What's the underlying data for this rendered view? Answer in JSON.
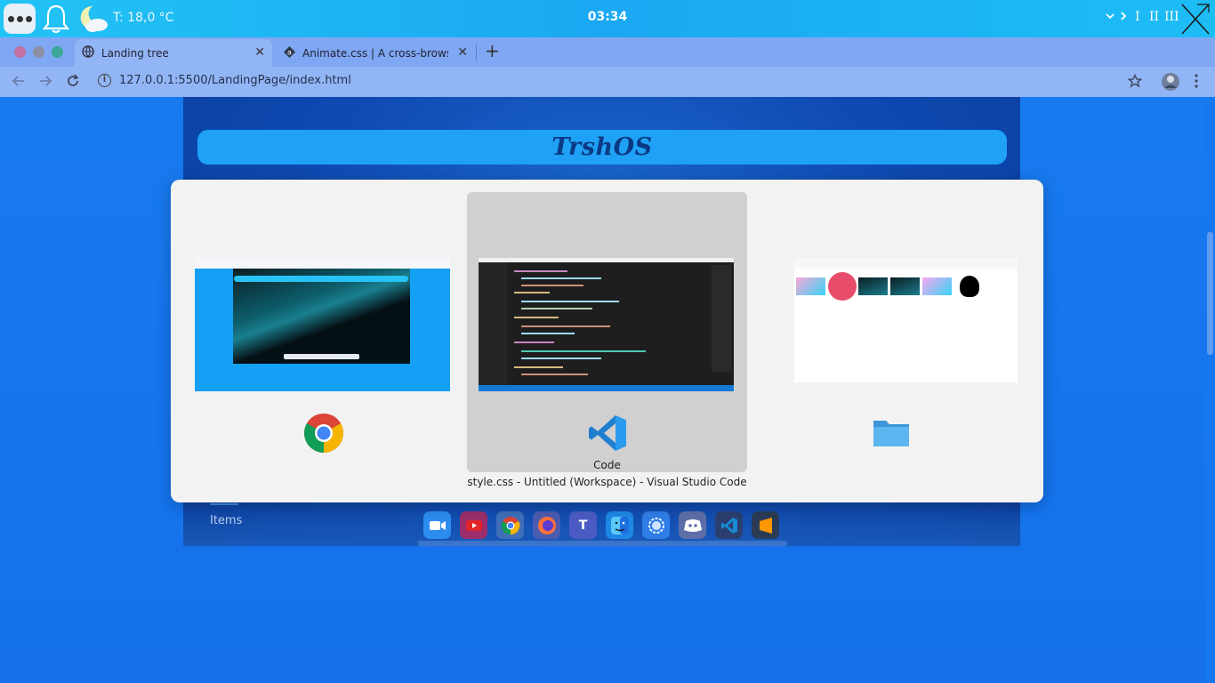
{
  "topbar": {
    "weather": "T: 18,0 °C",
    "clock": "03:34",
    "workspaces": [
      "I",
      "II",
      "III"
    ],
    "icons": [
      "menu-dots-icon",
      "bell-icon",
      "weather-moon-icon",
      "chevron-down-icon",
      "chevron-right-icon",
      "x-logo-icon"
    ]
  },
  "browser": {
    "tabs": [
      {
        "title": "Landing tree",
        "icon": "globe-icon",
        "active": true
      },
      {
        "title": "Animate.css | A cross-browser",
        "icon": "animate-logo-icon",
        "active": false
      }
    ],
    "url": "127.0.0.1:5500/LandingPage/index.html"
  },
  "page": {
    "banner_title": "TrshOS",
    "items_label": "Items"
  },
  "dock": {
    "apps": [
      "zoom",
      "youtube",
      "chrome",
      "firefox",
      "teams",
      "finder",
      "signal",
      "discord-like",
      "vscode",
      "sublime"
    ]
  },
  "switcher": {
    "apps": [
      {
        "name": "",
        "icon": "chrome-icon",
        "selected": false
      },
      {
        "name": "Code",
        "icon": "vscode-icon",
        "selected": true
      },
      {
        "name": "",
        "icon": "folder-icon",
        "selected": false
      }
    ],
    "window_title": "style.css - Untitled (Workspace) - Visual Studio Code"
  },
  "colors": {
    "desktop": "#1575ee",
    "topbar": "#1eb4f4",
    "tabstrip": "#7fa7f3",
    "toolbar": "#92b5f5",
    "banner": "#1fa1f6",
    "switcher": "#f2f2f2",
    "switcher_selected": "#d0d0d0"
  }
}
